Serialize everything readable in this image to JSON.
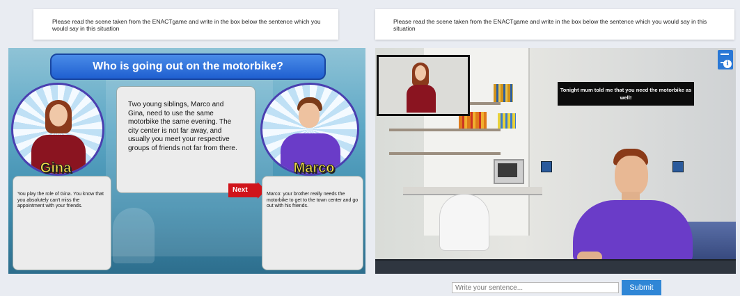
{
  "left_panel": {
    "instruction": "Please read the scene taken from the ENACTgame and write in the box below the sentence which you would say in this situation",
    "scene_title": "Who is going out on the motorbike?",
    "story": "Two young siblings, Marco and Gina, need to use the same motorbike the same evening. The city center is not far away, and usually you meet your respective groups of friends not far from there.",
    "left_character": {
      "name": "Gina",
      "description": "You play the role of Gina. You know that you absolutely can't miss the appointment with your friends."
    },
    "right_character": {
      "name": "Marco",
      "description": "Marco: your brother really needs the motorbike to get to the town center and go out with his friends."
    },
    "next_button": "Next"
  },
  "right_panel": {
    "instruction": "Please read the scene taken from the ENACTgame and write in the box below the sentence which you would say in this situation",
    "speech_bubble": "Tonight mum told me that you need the motorbike as well!",
    "info_icon": "document-info-icon"
  },
  "input": {
    "placeholder": "Write your sentence...",
    "value": ""
  },
  "submit_button": "Submit",
  "colors": {
    "accent": "#2f86d6",
    "banner": "#1f5fd0",
    "next": "#d0141b",
    "shirt_purple": "#6a3cc8",
    "shirt_red": "#8a1420"
  }
}
